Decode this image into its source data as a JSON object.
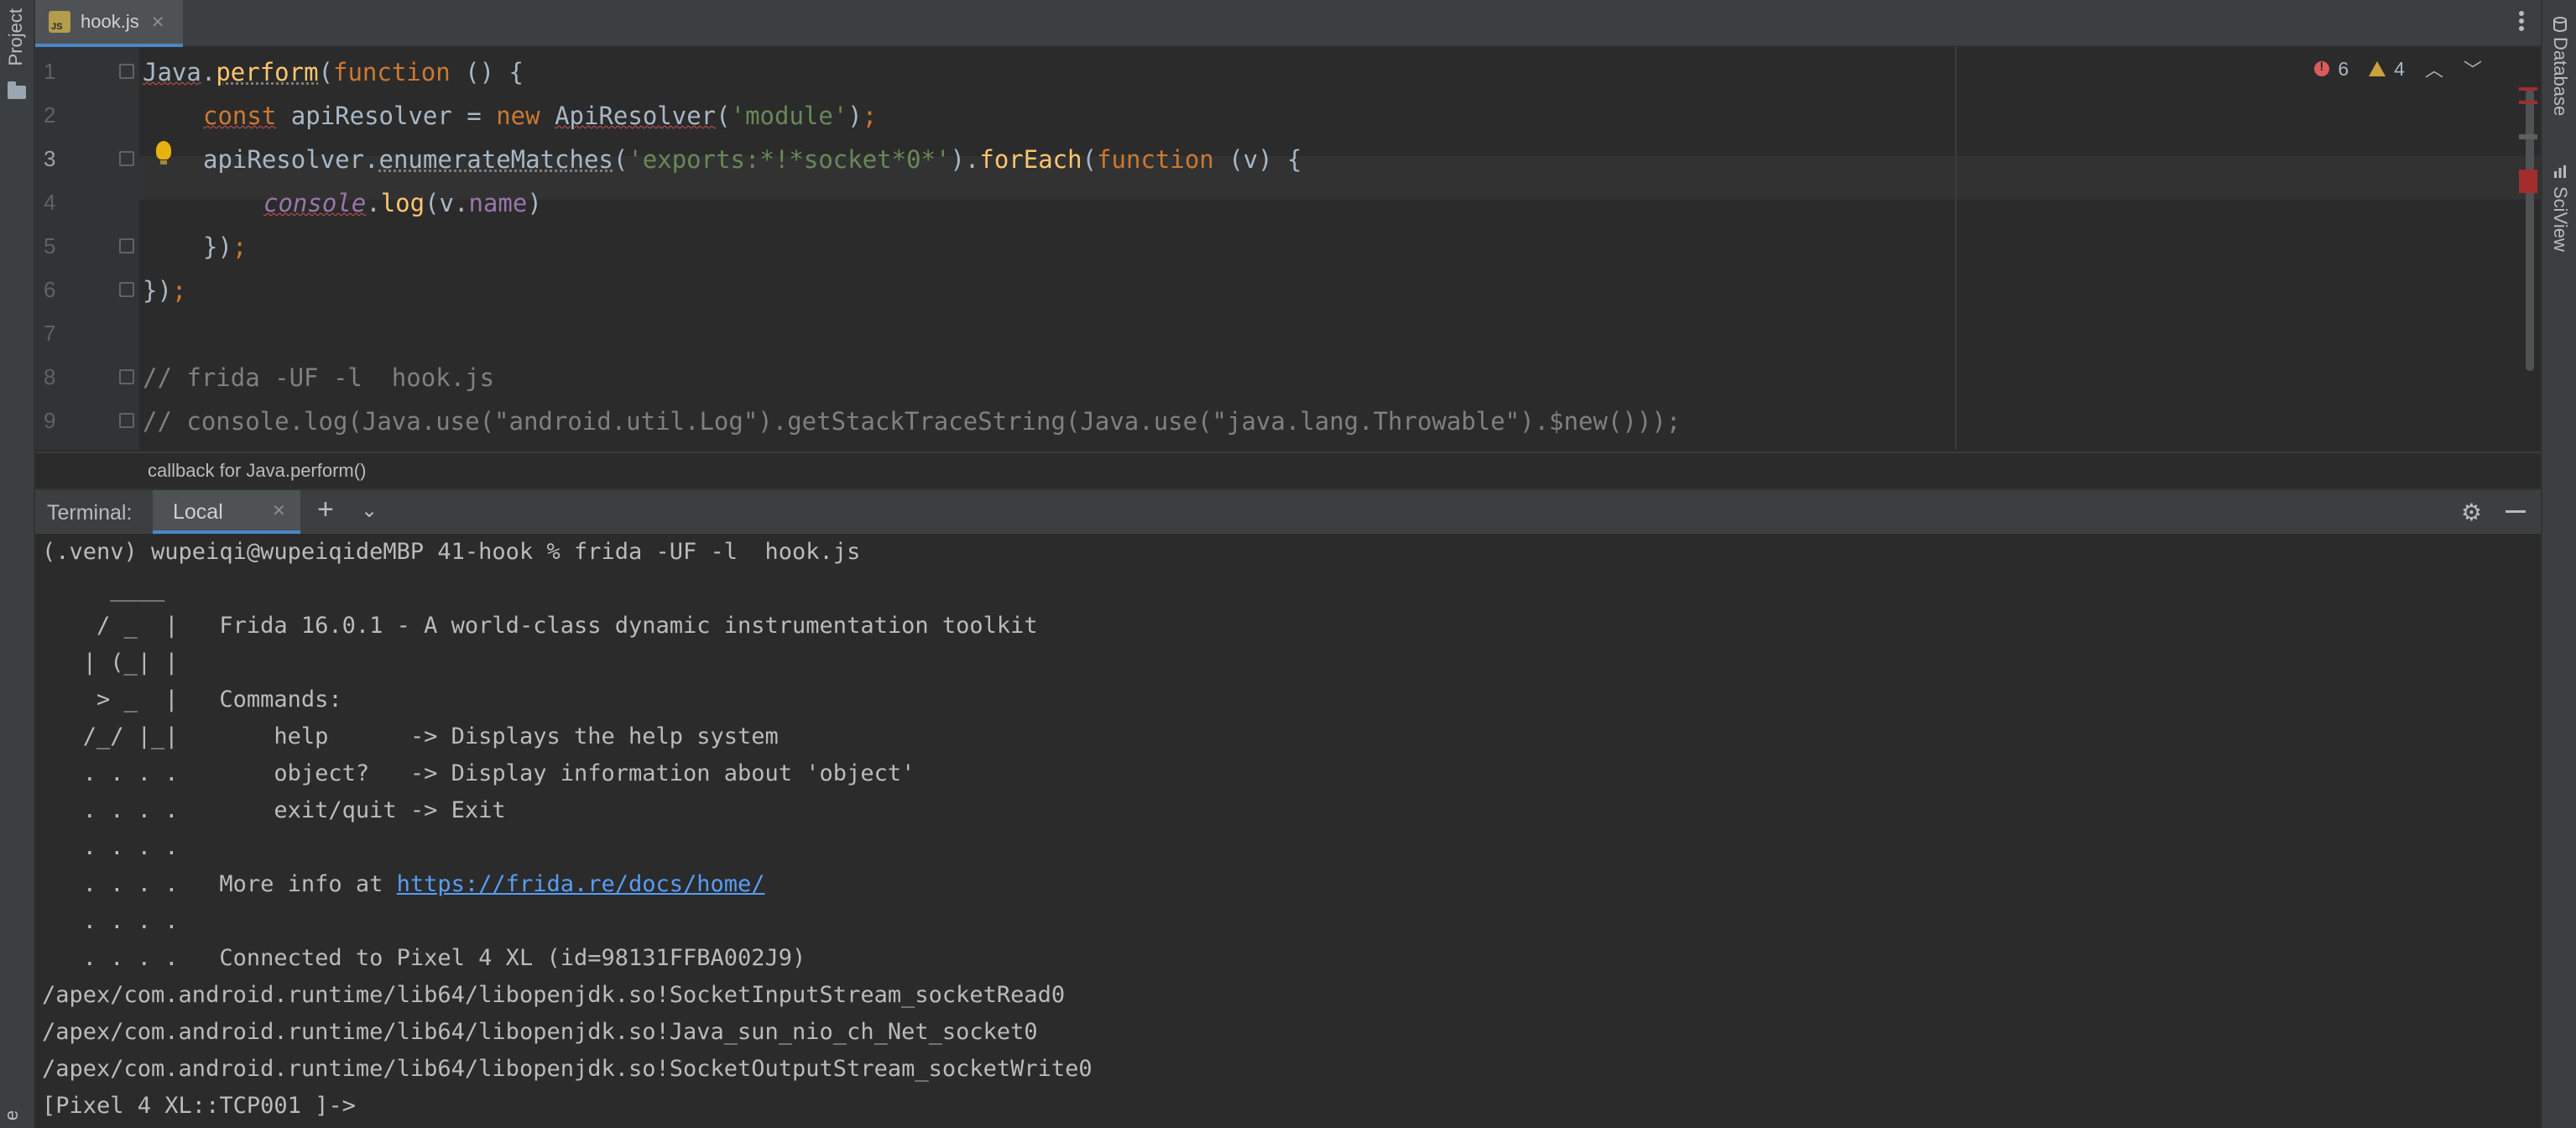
{
  "left_strip": {
    "project_label": "Project"
  },
  "right_strip": {
    "database_label": "Database",
    "sciview_label": "SciView"
  },
  "tabs": [
    {
      "label": "hook.js",
      "icon": "js-file-icon"
    }
  ],
  "editor": {
    "line_numbers": [
      "1",
      "2",
      "3",
      "4",
      "5",
      "6",
      "7",
      "8",
      "9"
    ],
    "line1": {
      "a": "Java",
      "b": ".",
      "c": "perform",
      "d": "(",
      "e": "function",
      "f": " () {"
    },
    "line2": {
      "a": "const",
      "b": " apiResolver = ",
      "c": "new",
      "d": " ",
      "e": "ApiResolver",
      "f": "(",
      "g": "'module'",
      "h": ")",
      "i": ";"
    },
    "line3": {
      "a": "apiResolver.",
      "b": "enumerateMatches",
      "c": "(",
      "d": "'exports:*!*socket*0*'",
      "e": ").",
      "f": "forEach",
      "g": "(",
      "h": "function",
      "i": " (v) {"
    },
    "line4": {
      "a": "console",
      "b": ".",
      "c": "log",
      "d": "(v.",
      "e": "name",
      "f": ")"
    },
    "line5": {
      "a": "})",
      "b": ";"
    },
    "line6": {
      "a": "})",
      "b": ";"
    },
    "line8": "// frida -UF -l  hook.js",
    "line9": "// console.log(Java.use(\"android.util.Log\").getStackTraceString(Java.use(\"java.lang.Throwable\").$new()));",
    "inspections": {
      "errors": "6",
      "warnings": "4"
    },
    "breadcrumb": "callback for Java.perform()"
  },
  "terminal": {
    "title": "Terminal:",
    "tab_label": "Local",
    "lines": [
      "(.venv) wupeiqi@wupeiqideMBP 41-hook % frida -UF -l  hook.js",
      "     ____",
      "    / _  |   Frida 16.0.1 - A world-class dynamic instrumentation toolkit",
      "   | (_| |",
      "    > _  |   Commands:",
      "   /_/ |_|       help      -> Displays the help system",
      "   . . . .       object?   -> Display information about 'object'",
      "   . . . .       exit/quit -> Exit",
      "   . . . .",
      "   . . . .   More info at ",
      "   . . . .",
      "   . . . .   Connected to Pixel 4 XL (id=98131FFBA002J9)",
      "/apex/com.android.runtime/lib64/libopenjdk.so!SocketInputStream_socketRead0",
      "/apex/com.android.runtime/lib64/libopenjdk.so!Java_sun_nio_ch_Net_socket0",
      "/apex/com.android.runtime/lib64/libopenjdk.so!SocketOutputStream_socketWrite0",
      "[Pixel 4 XL::TCP001 ]-> "
    ],
    "link": "https://frida.re/docs/home/"
  },
  "colors": {
    "keyword": "#cc7832",
    "function": "#ffc66d",
    "string": "#6a8759",
    "property": "#9876aa",
    "comment": "#808080",
    "link": "#589df6"
  }
}
